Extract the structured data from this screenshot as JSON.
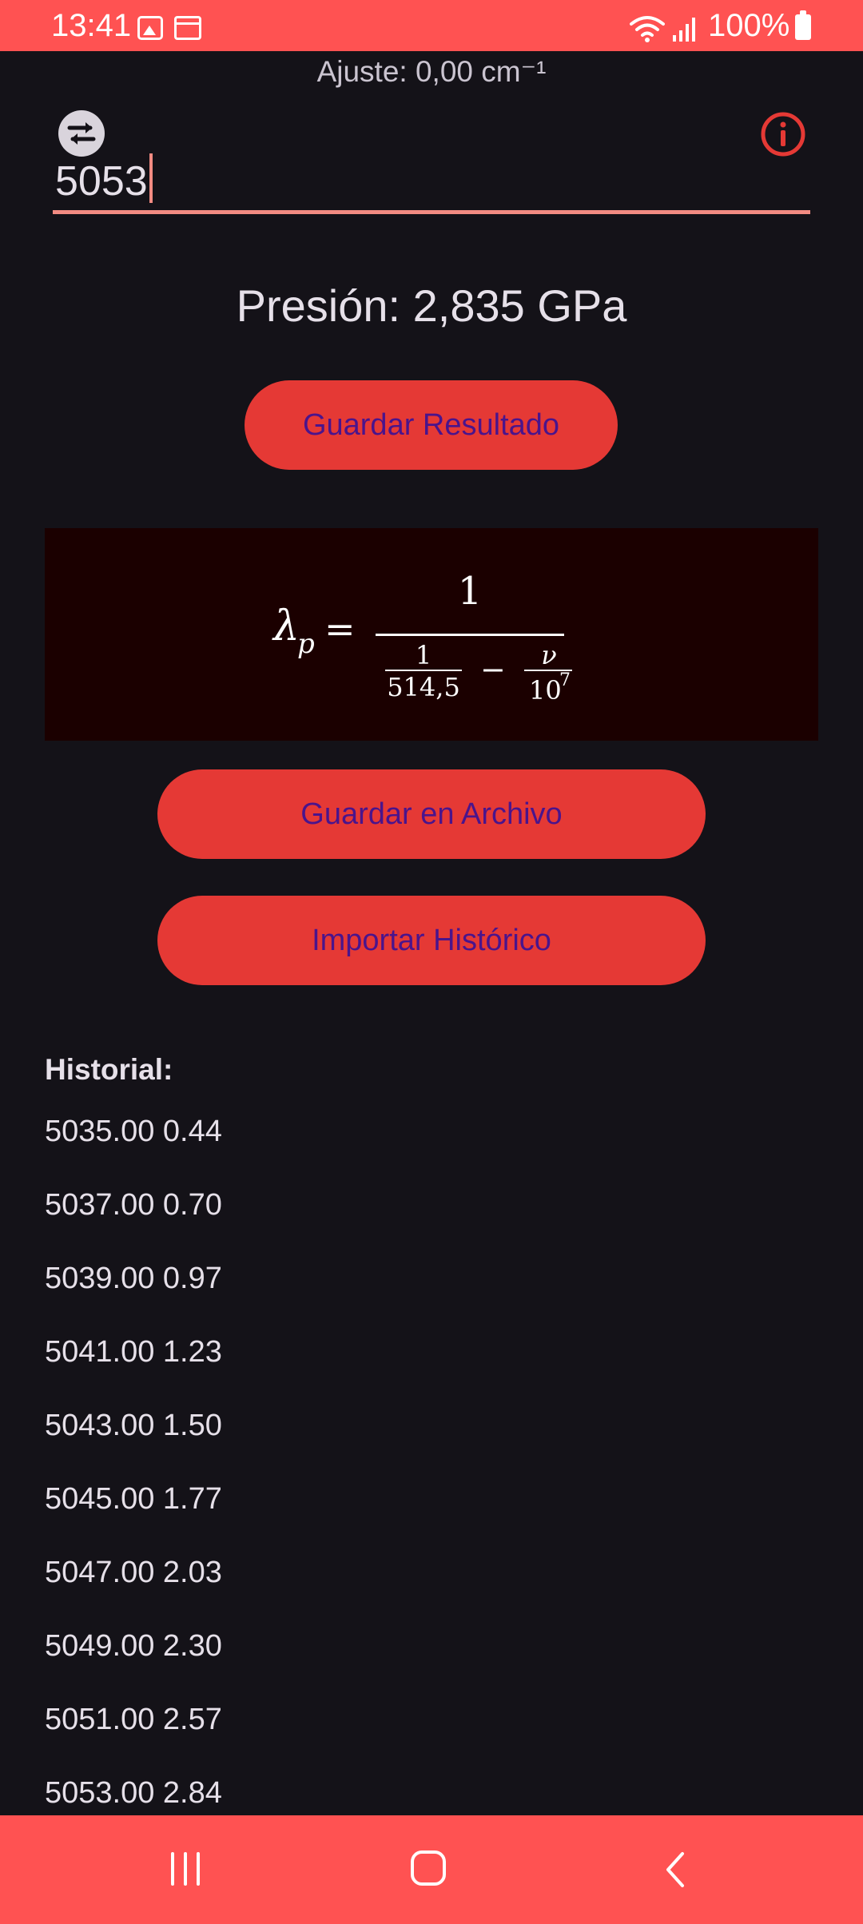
{
  "status_bar": {
    "time": "13:41",
    "battery": "100%",
    "icons": [
      "image-icon",
      "calendar-icon",
      "wifi-icon",
      "signal-icon",
      "battery-icon"
    ]
  },
  "adjust_label": "Ajuste: 0,00 cm⁻¹",
  "input": {
    "value": "5053"
  },
  "pressure_text": "Presión: 2,835 GPa",
  "buttons": {
    "save_result": "Guardar Resultado",
    "save_file": "Guardar en Archivo",
    "import_history": "Importar Histórico"
  },
  "formula": {
    "lhs": "λ",
    "lhs_sub": "p",
    "numerator": "1",
    "inner_num": "1",
    "inner_den": "514,5",
    "minus": "−",
    "nu": "ν",
    "ten": "10",
    "exp": "7",
    "equals": "="
  },
  "history": {
    "title": "Historial:",
    "items": [
      "5035.00 0.44",
      "5037.00 0.70",
      "5039.00 0.97",
      "5041.00 1.23",
      "5043.00 1.50",
      "5045.00 1.77",
      "5047.00 2.03",
      "5049.00 2.30",
      "5051.00 2.57",
      "5053.00 2.84"
    ]
  },
  "colors": {
    "accent": "#ff5252",
    "button": "#e53935",
    "button_text": "#4a148c",
    "background": "#141218",
    "formula_bg": "#1b0000"
  }
}
